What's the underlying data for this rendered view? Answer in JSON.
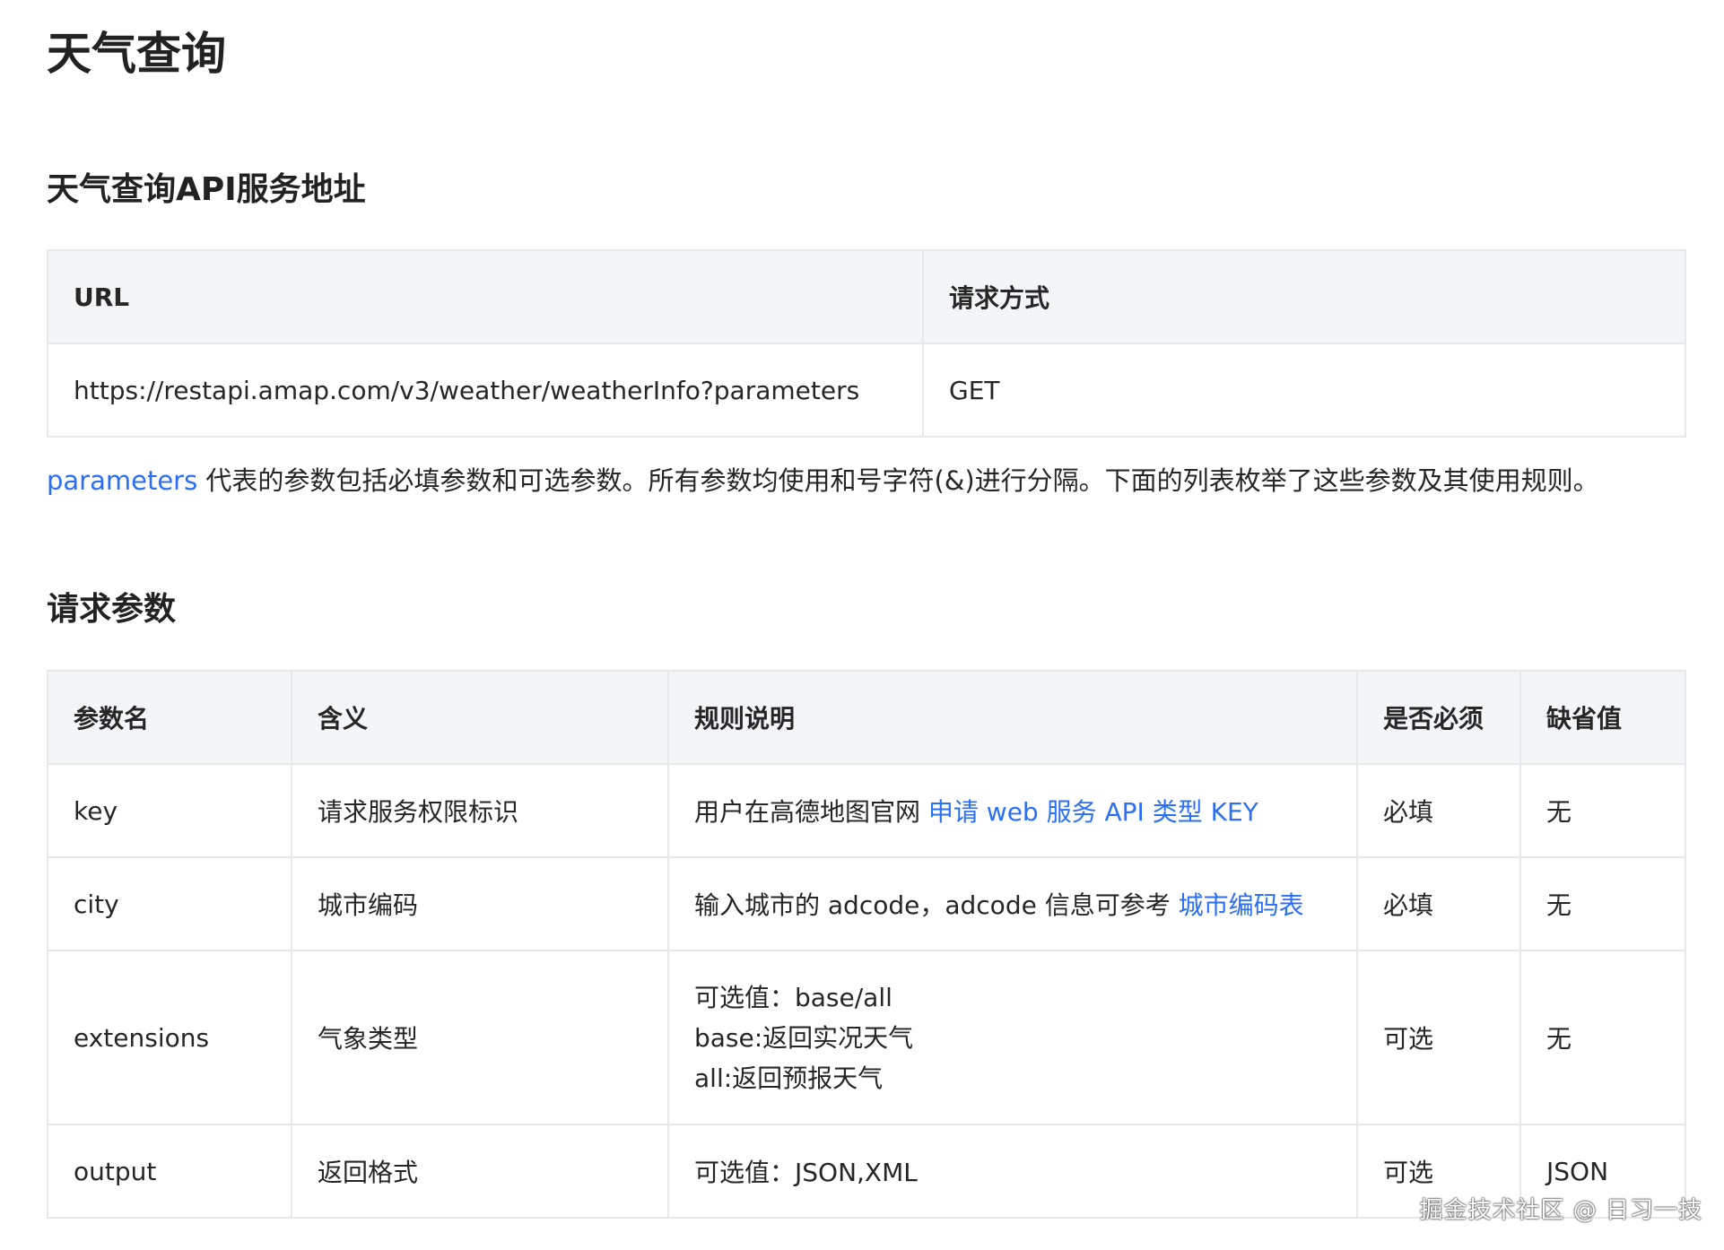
{
  "page_title": "天气查询",
  "service_section": {
    "heading": "天气查询API服务地址",
    "table": {
      "headers": [
        "URL",
        "请求方式"
      ],
      "row": [
        "https://restapi.amap.com/v3/weather/weatherInfo?parameters",
        "GET"
      ]
    }
  },
  "description": {
    "link_text": "parameters",
    "text": " 代表的参数包括必填参数和可选参数。所有参数均使用和号字符(&)进行分隔。下面的列表枚举了这些参数及其使用规则。"
  },
  "params_section": {
    "heading": "请求参数",
    "headers": [
      "参数名",
      "含义",
      "规则说明",
      "是否必须",
      "缺省值"
    ],
    "rows": [
      {
        "name": "key",
        "meaning": "请求服务权限标识",
        "rule_text": "用户在高德地图官网 ",
        "rule_link": "申请 web 服务 API 类型 KEY",
        "required": "必填",
        "default": "无"
      },
      {
        "name": "city",
        "meaning": "城市编码",
        "rule_text": "输入城市的 adcode，adcode 信息可参考 ",
        "rule_link": "城市编码表",
        "required": "必填",
        "default": "无"
      },
      {
        "name": "extensions",
        "meaning": "气象类型",
        "rule_lines": [
          "可选值：base/all",
          "base:返回实况天气",
          "all:返回预报天气"
        ],
        "required": "可选",
        "default": "无"
      },
      {
        "name": "output",
        "meaning": "返回格式",
        "rule_text": "可选值：JSON,XML",
        "required": "可选",
        "default": "JSON"
      }
    ]
  },
  "watermark": "掘金技术社区 @ 日习一技",
  "colors": {
    "link": "#2b6ff6",
    "header_bg": "#f4f5f7",
    "border": "#e6e8eb",
    "text": "#262626"
  }
}
